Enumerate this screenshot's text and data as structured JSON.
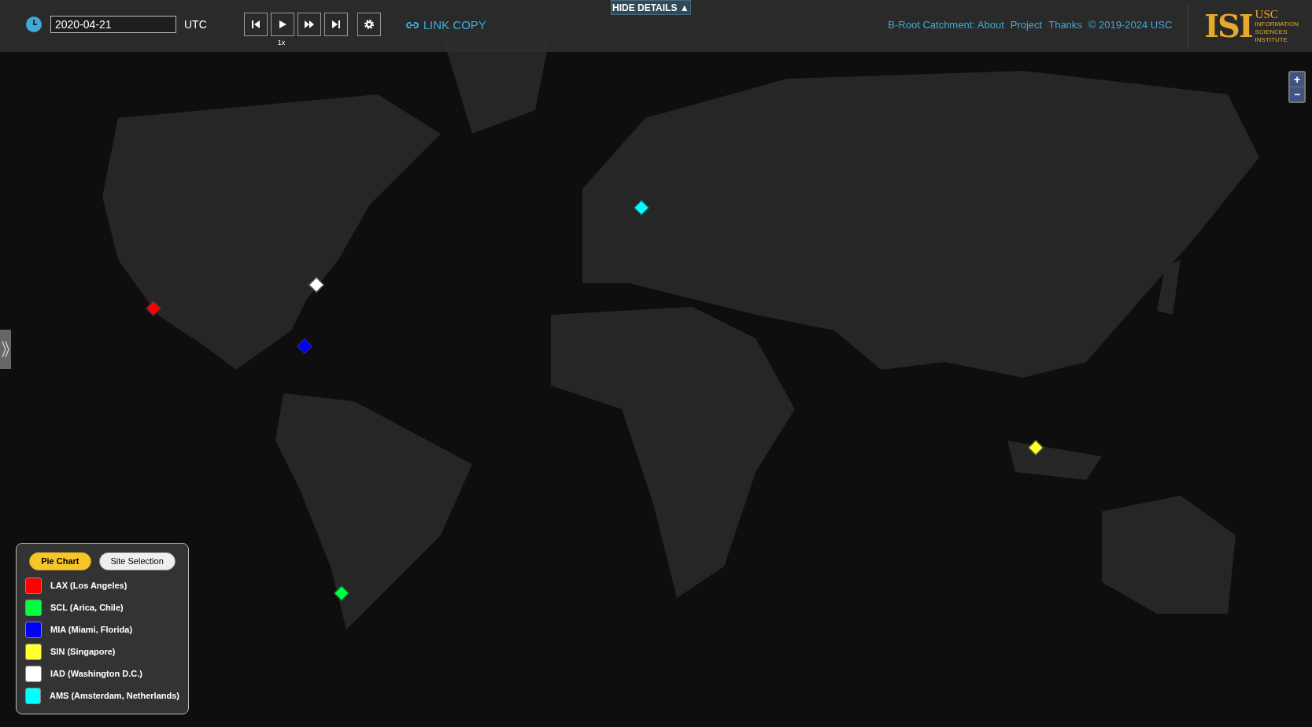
{
  "header": {
    "date": "2020-04-21",
    "timezone": "UTC",
    "speed": "1x",
    "link_copy": "LINK COPY",
    "hide_details": "HIDE DETAILS ▲",
    "links": [
      "B-Root Catchment: About",
      "Project",
      "Thanks",
      "© 2019-2024 USC"
    ],
    "logo": {
      "mark": "ISI",
      "org": "USC",
      "lines": [
        "INFORMATION",
        "SCIENCES",
        "INSTITUTE"
      ]
    }
  },
  "map": {
    "zoom_in": "+",
    "zoom_out": "−"
  },
  "legend": {
    "modes": [
      {
        "label": "Pie Chart",
        "selected": true
      },
      {
        "label": "Site Selection",
        "selected": false
      }
    ],
    "sites": [
      {
        "label": "LAX (Los Angeles)",
        "color": "#ff0000"
      },
      {
        "label": "SCL (Arica, Chile)",
        "color": "#00ff40"
      },
      {
        "label": "MIA (Miami, Florida)",
        "color": "#0000ff"
      },
      {
        "label": "SIN (Singapore)",
        "color": "#ffff33"
      },
      {
        "label": "IAD (Washington D.C.)",
        "color": "#ffffff"
      },
      {
        "label": "AMS (Amsterdam, Netherlands)",
        "color": "#00ffff"
      }
    ]
  }
}
